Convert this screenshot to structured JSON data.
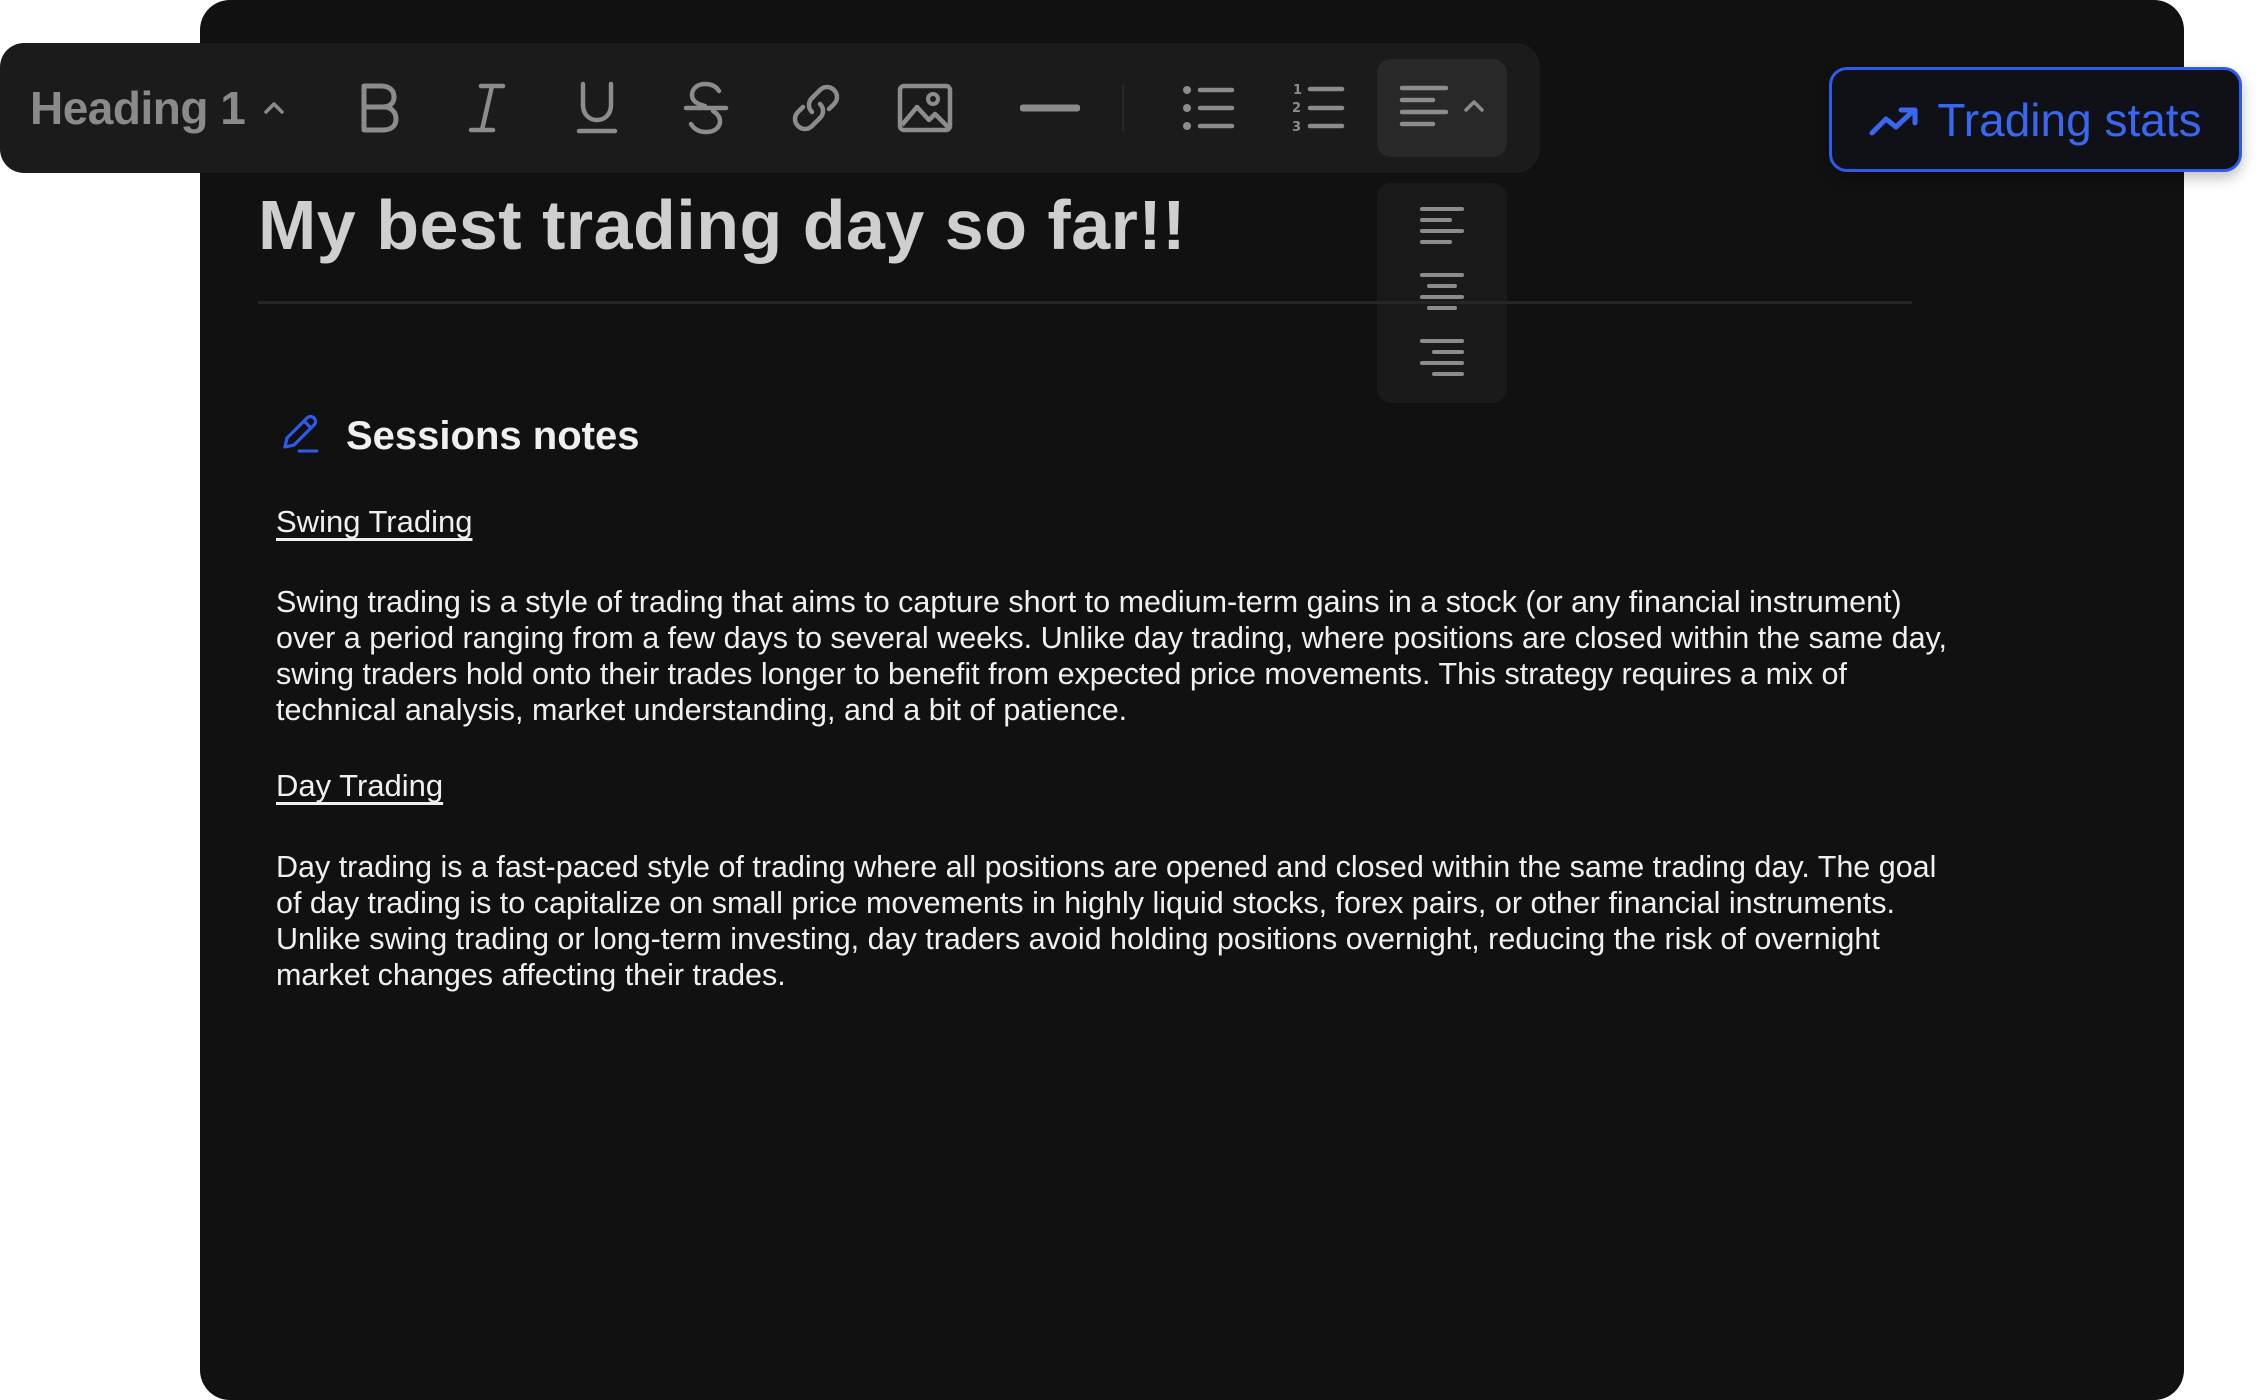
{
  "toolbar": {
    "heading_select": "Heading 1",
    "icons": [
      "bold-icon",
      "italic-icon",
      "underline-icon",
      "strikethrough-icon",
      "link-icon",
      "image-icon",
      "horizontal-rule-icon",
      "bullet-list-icon",
      "numbered-list-icon",
      "align-left-icon"
    ]
  },
  "align_menu": {
    "options": [
      "align-left-icon",
      "align-center-icon",
      "align-right-icon"
    ]
  },
  "stats_button": {
    "label": "Trading stats",
    "icon": "trending-up-icon",
    "color": "#2f5bea"
  },
  "document": {
    "title": "My best trading day so far!!",
    "section": {
      "icon": "pencil-icon",
      "title": "Sessions notes"
    },
    "subsections": [
      {
        "heading": "Swing Trading",
        "text": "Swing trading is a style of trading that aims to capture short to medium-term gains in a stock (or any financial instrument) over a period ranging from a few days to several weeks. Unlike day trading, where positions are closed within the same day, swing traders hold onto their trades longer to benefit from expected price movements. This strategy requires a mix of technical analysis, market understanding, and a bit of patience."
      },
      {
        "heading": "Day Trading",
        "text": "Day trading is a fast-paced style of trading where all positions are opened and closed within the same trading day. The goal of day trading is to capitalize on small price movements in highly liquid stocks, forex pairs, or other financial instruments. Unlike swing trading or long-term investing, day traders avoid holding positions overnight, reducing the risk of overnight market changes affecting their trades."
      }
    ]
  },
  "colors": {
    "background": "#111111",
    "toolbar": "#1b1b1b",
    "accent": "#2f5bea",
    "text": "#f0f0f0"
  }
}
